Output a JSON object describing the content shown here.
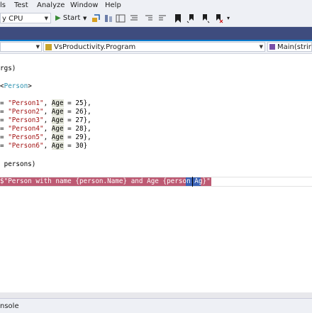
{
  "menu": [
    "ls",
    "Test",
    "Analyze",
    "Window",
    "Help"
  ],
  "toolbar": {
    "platform": "y CPU",
    "start_label": "Start"
  },
  "navbar": {
    "project": "",
    "type": "VsProductivity.Program",
    "member": "Main(string"
  },
  "code": {
    "line1": "rgs)",
    "line2_prefix": "<",
    "line2_type": "Person",
    "line2_suffix": ">",
    "persons": [
      {
        "name": "\"Person1\"",
        "age": "25",
        "end": "},"
      },
      {
        "name": "\"Person2\"",
        "age": "26",
        "end": "},"
      },
      {
        "name": "\"Person3\"",
        "age": "27",
        "end": "},"
      },
      {
        "name": "\"Person4\"",
        "age": "28",
        "end": "},"
      },
      {
        "name": "\"Person5\"",
        "age": "29",
        "end": "},"
      },
      {
        "name": "\"Person6\"",
        "age": "30",
        "end": "}"
      }
    ],
    "foreach_tail": " persons)",
    "selected_line_a": "$\"Person with name {person.Name} and Age {person.",
    "selected_line_b": "A",
    "selected_line_c": "g",
    "selected_line_d": "}\");"
  },
  "tokens": {
    "eq": "= ",
    "comma_age": ", ",
    "age_kw": "Age",
    "eq2": " = "
  },
  "status": {
    "panel": "nsole"
  },
  "colors": {
    "accent": "#007acc",
    "tabstrip": "#3e4c7e",
    "selection": "#bd5a73",
    "string": "#a31515",
    "type": "#2b91af"
  }
}
